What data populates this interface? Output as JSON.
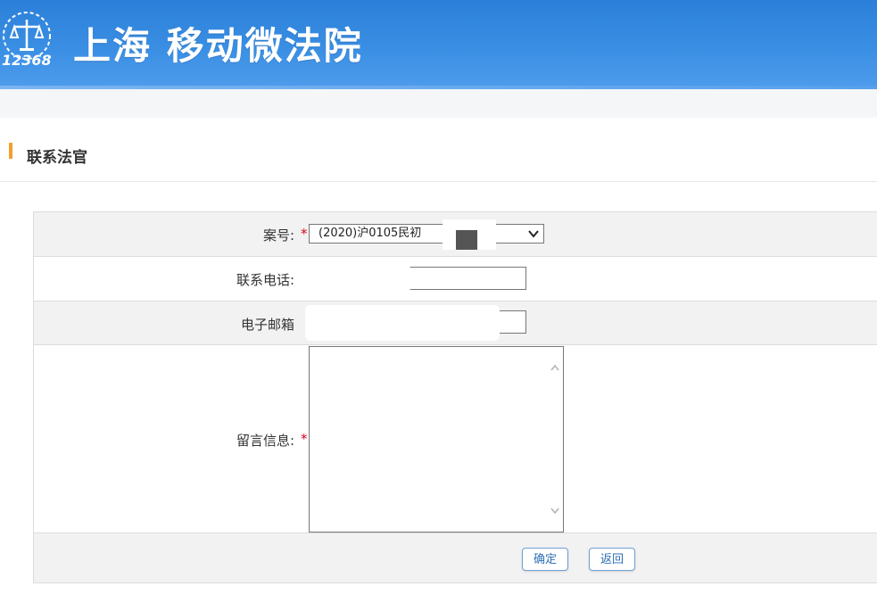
{
  "header": {
    "site_title": "上海 移动微法院",
    "logo_number": "12368"
  },
  "section": {
    "title": "联系法官"
  },
  "form": {
    "case_number": {
      "label": "案号:",
      "selected_value": "(2020)沪0105民初"
    },
    "phone": {
      "label": "联系电话:"
    },
    "email": {
      "label": "电子邮箱"
    },
    "message": {
      "label": "留言信息:"
    },
    "required_mark": "*"
  },
  "buttons": {
    "confirm": "确定",
    "back": "返回"
  },
  "colors": {
    "header_blue": "#3a8fe4",
    "accent": "#f0a030",
    "required": "#d9001b",
    "button_text": "#2f6fb5"
  }
}
